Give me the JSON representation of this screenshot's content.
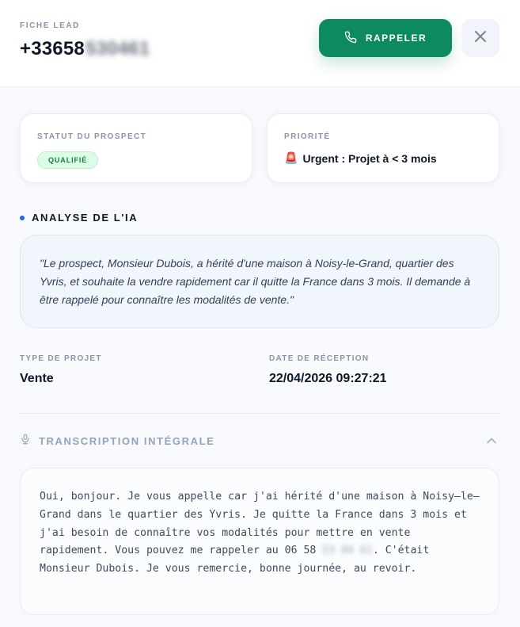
{
  "header": {
    "eyebrow": "FICHE LEAD",
    "phone_visible": "+33658",
    "phone_masked": "530461",
    "call_label": "RAPPELER",
    "call_icon": "phone-icon",
    "close_icon": "close-icon"
  },
  "status_card": {
    "label": "STATUT DU PROSPECT",
    "badge": "QUALIFIÉ"
  },
  "priority_card": {
    "label": "PRIORITÉ",
    "icon": "🚨",
    "value": "Urgent : Projet à < 3 mois"
  },
  "ai_section": {
    "title": "ANALYSE DE L'IA",
    "text": "\"Le prospect, Monsieur Dubois, a hérité d'une maison à Noisy-le-Grand, quartier des Yvris, et souhaite la vendre rapidement car il quitte la France dans 3 mois. Il demande à être rappelé pour connaître les modalités de vente.\""
  },
  "details": {
    "type_label": "TYPE DE PROJET",
    "type_value": "Vente",
    "date_label": "DATE DE RÉCEPTION",
    "date_value": "22/04/2026 09:27:21"
  },
  "transcription": {
    "title": "TRANSCRIPTION INTÉGRALE",
    "icon": "microphone-icon",
    "toggle_icon": "chevron-up-icon",
    "text_before": "Oui, bonjour. Je vous appelle car j'ai hérité d'une maison à Noisy–le–Grand dans le quartier des Yvris. Je quitte la France dans 3 mois et j'ai besoin de connaître vos modalités pour mettre en vente rapidement. Vous pouvez me rappeler au 06 58",
    "text_masked": "53 04 61",
    "text_after": ". C'était Monsieur Dubois. Je vous remercie, bonne journée, au revoir."
  },
  "colors": {
    "accent_green": "#0e8a5f",
    "badge_green_bg": "#dcfce7",
    "ai_dot_blue": "#2563eb",
    "ai_box_bg": "#f1f6fd"
  }
}
